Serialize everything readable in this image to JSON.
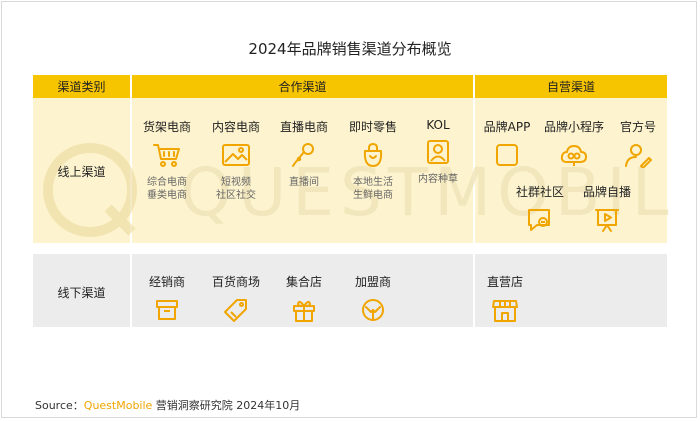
{
  "title": "2024年品牌销售渠道分布概览",
  "headers": {
    "channel_type": "渠道类别",
    "partner": "合作渠道",
    "own": "自营渠道"
  },
  "rows": {
    "online": "线上渠道",
    "offline": "线下渠道"
  },
  "online_partner": [
    {
      "name": "货架电商",
      "icon": "cart-icon",
      "sub": [
        "综合电商",
        "垂类电商"
      ]
    },
    {
      "name": "内容电商",
      "icon": "image-icon",
      "sub": [
        "短视频",
        "社区社交"
      ]
    },
    {
      "name": "直播电商",
      "icon": "microphone-icon",
      "sub": [
        "直播间"
      ]
    },
    {
      "name": "即时零售",
      "icon": "shopping-bag-icon",
      "sub": [
        "本地生活",
        "生鲜电商"
      ]
    },
    {
      "name": "KOL",
      "icon": "portrait-icon",
      "sub": [
        "内容种草"
      ]
    }
  ],
  "online_own": [
    {
      "name": "品牌APP",
      "icon": "app-square-icon"
    },
    {
      "name": "品牌小程序",
      "icon": "mini-program-icon"
    },
    {
      "name": "官方号",
      "icon": "account-edit-icon"
    },
    {
      "name": "社群社区",
      "icon": "chat-bubble-icon"
    },
    {
      "name": "品牌自播",
      "icon": "screen-play-icon"
    }
  ],
  "offline_partner": [
    {
      "name": "经销商",
      "icon": "box-icon"
    },
    {
      "name": "百货商场",
      "icon": "tag-icon"
    },
    {
      "name": "集合店",
      "icon": "gift-icon"
    },
    {
      "name": "加盟商",
      "icon": "handshake-circle-icon"
    }
  ],
  "offline_own": [
    {
      "name": "直营店",
      "icon": "store-icon"
    }
  ],
  "source": {
    "prefix": "Source：",
    "brand": "QuestMobile",
    "suffix": " 营销洞察研究院 2024年10月"
  },
  "watermark": "QUESTMOBILE",
  "colors": {
    "accent": "#f7c500",
    "panel": "#fdf4cf",
    "offline_panel": "#ececec"
  }
}
